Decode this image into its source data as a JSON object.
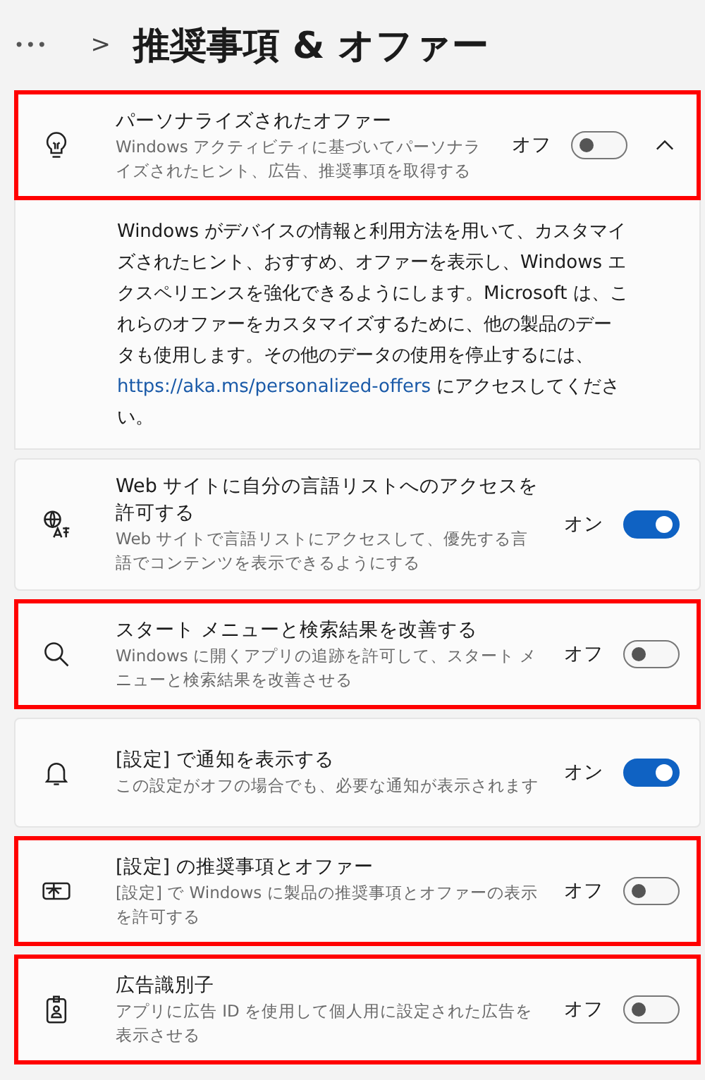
{
  "breadcrumb": {
    "ellipsis": "•••",
    "separator": ">",
    "title": "推奨事項 & オファー"
  },
  "settings": [
    {
      "kind": "toggle",
      "title": "パーソナライズされたオファー",
      "description": "Windows アクティビティに基づいてパーソナライズされたヒント、広告、推奨事項を取得する",
      "state_label": "オフ",
      "on": false,
      "highlighted": true,
      "expanded": true,
      "details": {
        "text_before": "Windows がデバイスの情報と利用方法を用いて、カスタマイズされたヒント、おすすめ、オファーを表示し、Windows エクスペリエンスを強化できるようにします。Microsoft は、これらのオファーをカスタマイズするために、他の製品のデータも使用します。その他のデータの使用を停止するには、",
        "link": "https://aka.ms/personalized-offers",
        "text_after": " にアクセスしてください。"
      }
    },
    {
      "kind": "toggle",
      "title": "Web サイトに自分の言語リストへのアクセスを許可する",
      "description": "Web サイトで言語リストにアクセスして、優先する言語でコンテンツを表示できるようにする",
      "state_label": "オン",
      "on": true,
      "highlighted": false
    },
    {
      "kind": "toggle",
      "title": "スタート メニューと検索結果を改善する",
      "description": "Windows に開くアプリの追跡を許可して、スタート メニューと検索結果を改善させる",
      "state_label": "オフ",
      "on": false,
      "highlighted": true
    },
    {
      "kind": "toggle",
      "title": "[設定] で通知を表示する",
      "description": "この設定がオフの場合でも、必要な通知が表示されます",
      "state_label": "オン",
      "on": true,
      "highlighted": false
    },
    {
      "kind": "toggle",
      "title": "[設定] の推奨事項とオファー",
      "description": "[設定] で Windows に製品の推奨事項とオファーの表示を許可する",
      "state_label": "オフ",
      "on": false,
      "highlighted": true
    },
    {
      "kind": "toggle",
      "title": "広告識別子",
      "description": "アプリに広告 ID を使用して個人用に設定された広告を表示させる",
      "state_label": "オフ",
      "on": false,
      "highlighted": true
    }
  ]
}
